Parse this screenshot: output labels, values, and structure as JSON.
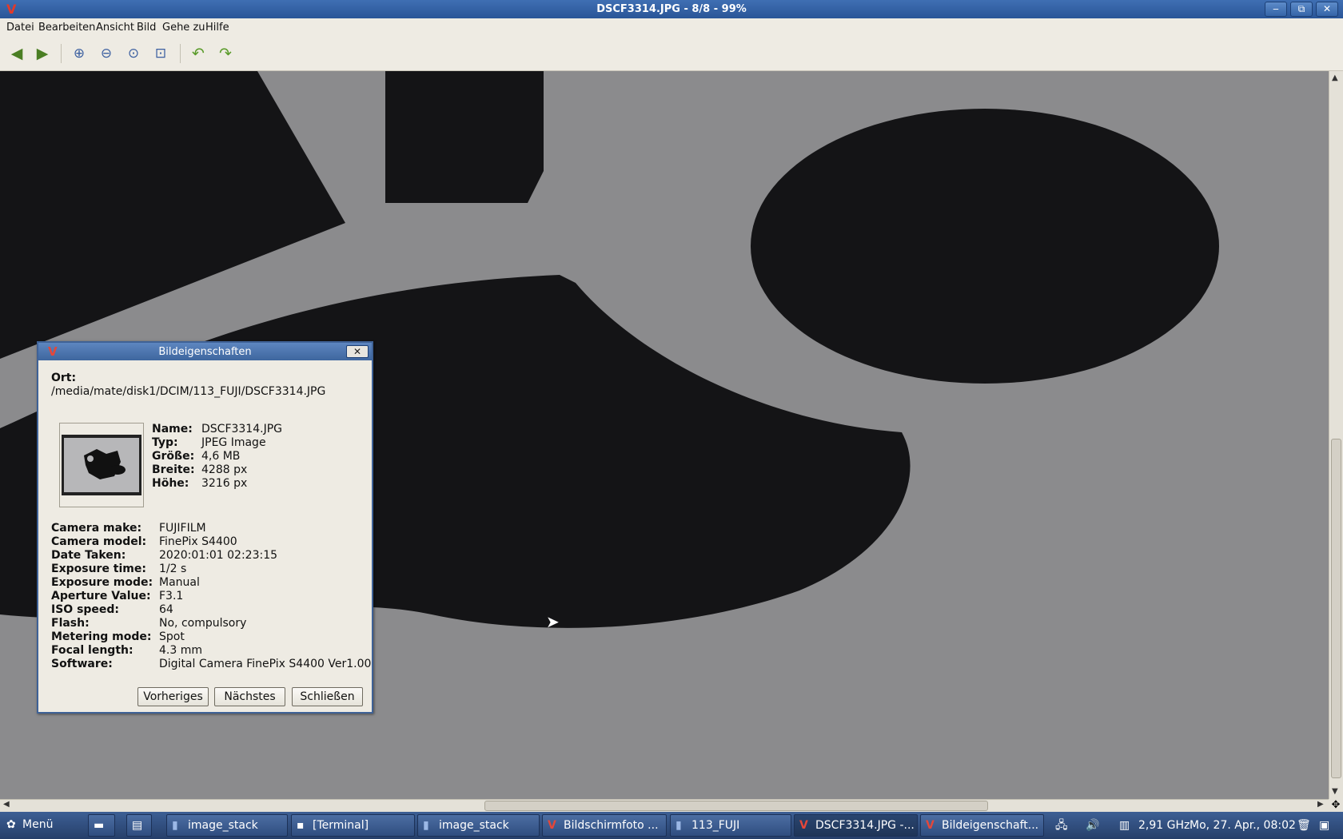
{
  "window": {
    "title": "DSCF3314.JPG - 8/8 - 99%",
    "app_logo": "V",
    "minimize": "‒",
    "maximize": "⧉",
    "close": "✕"
  },
  "menu": [
    "Datei",
    "Bearbeiten",
    "Ansicht",
    "Bild",
    "Gehe zu",
    "Hilfe"
  ],
  "toolbar": {
    "back_icon": "arrow-left-icon",
    "forward_icon": "arrow-right-icon",
    "zoom_in_icon": "zoom-in-icon",
    "zoom_out_icon": "zoom-out-icon",
    "zoom_normal_icon": "zoom-normal-icon",
    "zoom_fit_icon": "zoom-fit-icon",
    "rotate_left_icon": "rotate-left-icon",
    "rotate_right_icon": "rotate-right-icon"
  },
  "dialog": {
    "title": "Bildeigenschaften",
    "logo": "V",
    "close": "✕",
    "location_label": "Ort:",
    "location_value": "/media/mate/disk1/DCIM/113_FUJI/DSCF3314.JPG",
    "basic": [
      {
        "label": "Name:",
        "value": "DSCF3314.JPG"
      },
      {
        "label": "Typ:",
        "value": "JPEG Image"
      },
      {
        "label": "Größe:",
        "value": "4,6 MB"
      },
      {
        "label": "Breite:",
        "value": "4288 px"
      },
      {
        "label": "Höhe:",
        "value": "3216 px"
      }
    ],
    "exif": [
      {
        "label": "Camera make:",
        "value": "FUJIFILM"
      },
      {
        "label": "Camera model:",
        "value": "FinePix S4400"
      },
      {
        "label": "Date Taken:",
        "value": "2020:01:01 02:23:15"
      },
      {
        "label": "Exposure time:",
        "value": "1/2 s"
      },
      {
        "label": "Exposure mode:",
        "value": "Manual"
      },
      {
        "label": "Aperture Value:",
        "value": "F3.1"
      },
      {
        "label": "ISO speed:",
        "value": "64"
      },
      {
        "label": "Flash:",
        "value": "No, compulsory"
      },
      {
        "label": "Metering mode:",
        "value": "Spot"
      },
      {
        "label": "Focal length:",
        "value": "4.3 mm"
      },
      {
        "label": "Software:",
        "value": "Digital Camera FinePix S4400 Ver1.00"
      }
    ],
    "buttons": {
      "prev": "Vorheriges",
      "next": "Nächstes",
      "close": "Schließen"
    }
  },
  "taskbar": {
    "menu_label": "Menü",
    "tasks": [
      {
        "label": "image_stack",
        "icon": "folder-icon"
      },
      {
        "label": "[Terminal]",
        "icon": "terminal-icon"
      },
      {
        "label": "image_stack",
        "icon": "folder-icon"
      },
      {
        "label": "Bildschirmfoto ...",
        "icon": "viewer-icon"
      },
      {
        "label": "113_FUJI",
        "icon": "folder-icon"
      },
      {
        "label": "DSCF3314.JPG -...",
        "icon": "viewer-icon"
      },
      {
        "label": "Bildeigenschaft...",
        "icon": "viewer-icon"
      }
    ],
    "cpu": "2,91 GHz",
    "clock": "Mo, 27. Apr., 08:02"
  }
}
